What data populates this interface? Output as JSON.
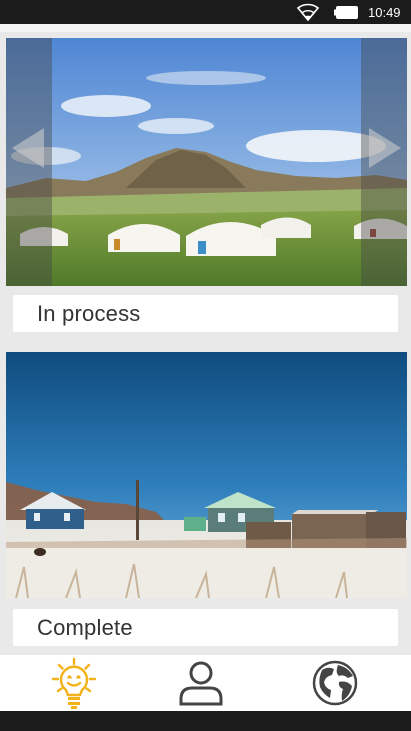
{
  "status_bar": {
    "time": "10:49",
    "icons": [
      "wifi-icon",
      "battery-icon"
    ]
  },
  "cards": [
    {
      "photo": "steppe-gers-photo",
      "status_label": "In process"
    },
    {
      "photo": "winter-village-photo",
      "status_label": "Complete"
    }
  ],
  "carousel": {
    "prev_icon": "chevron-left-icon",
    "next_icon": "chevron-right-icon"
  },
  "bottom_nav": {
    "items": [
      {
        "icon": "lightbulb-icon",
        "active": true
      },
      {
        "icon": "person-icon",
        "active": false
      },
      {
        "icon": "globe-icon",
        "active": false
      }
    ]
  },
  "colors": {
    "accent": "#f2b21a",
    "icon_inactive": "#444444",
    "status_bar": "#1b1b1b",
    "background": "#e9e9e9"
  }
}
